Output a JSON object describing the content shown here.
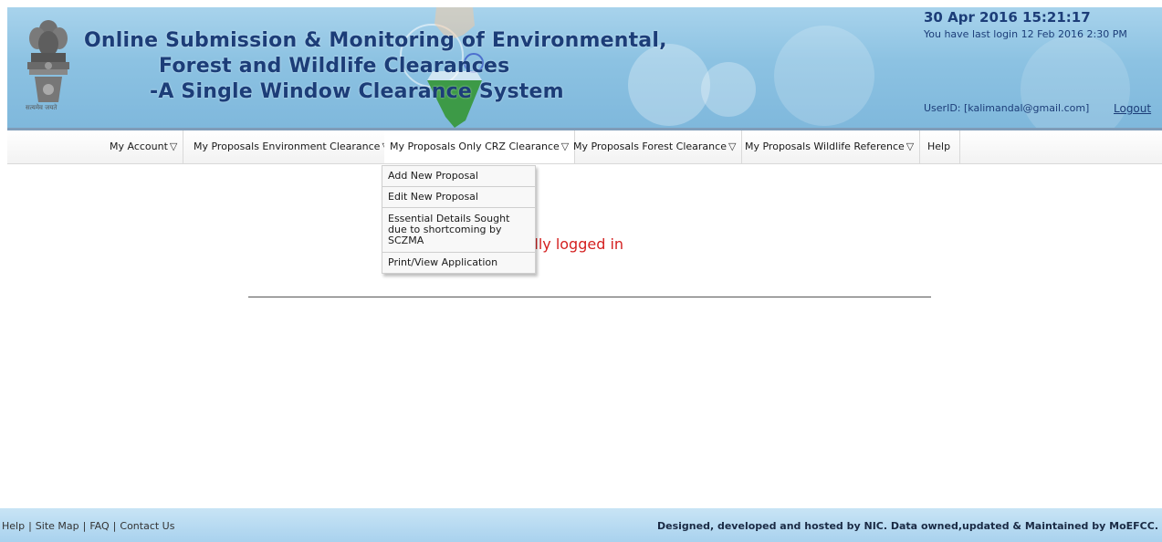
{
  "header": {
    "title_lines": [
      "Online Submission & Monitoring of Environmental,",
      "Forest and Wildlife Clearances",
      "-A Single Window Clearance System"
    ],
    "emblem_caption": "सत्यमेव जयते",
    "date_time": "30 Apr 2016   15:21:17",
    "last_login": "You have last login 12 Feb 2016 2:30 PM",
    "user_id": "UserID: [kalimandal@gmail.com]",
    "logout_label": "Logout"
  },
  "nav": {
    "items": [
      {
        "label": "My Account",
        "arrow": "▽"
      },
      {
        "label": "My Proposals Environment Clearance",
        "arrow": "▽"
      },
      {
        "label": "My Proposals Only CRZ Clearance",
        "arrow": "▽"
      },
      {
        "label": "My Proposals Forest Clearance",
        "arrow": "▽"
      },
      {
        "label": "My Proposals Wildlife Reference",
        "arrow": "▽"
      },
      {
        "label": "Help",
        "arrow": ""
      }
    ],
    "open_menu": {
      "items": [
        "Add New Proposal",
        "Edit New Proposal",
        "Essential Details Sought due to shortcoming by SCZMA",
        "Print/View Application"
      ]
    }
  },
  "main": {
    "welcome_message": "You have successfully logged in"
  },
  "footer": {
    "links": [
      "Help",
      "Site Map",
      "FAQ",
      "Contact Us"
    ],
    "separator": "|",
    "credit": "Designed, developed and hosted by NIC. Data owned,updated & Maintained by MoEFCC."
  },
  "colors": {
    "header_bg": "#8cc2e2",
    "title_text": "#1c3d78",
    "welcome_text": "#d42020",
    "footer_bg": "#a9d2ee"
  }
}
